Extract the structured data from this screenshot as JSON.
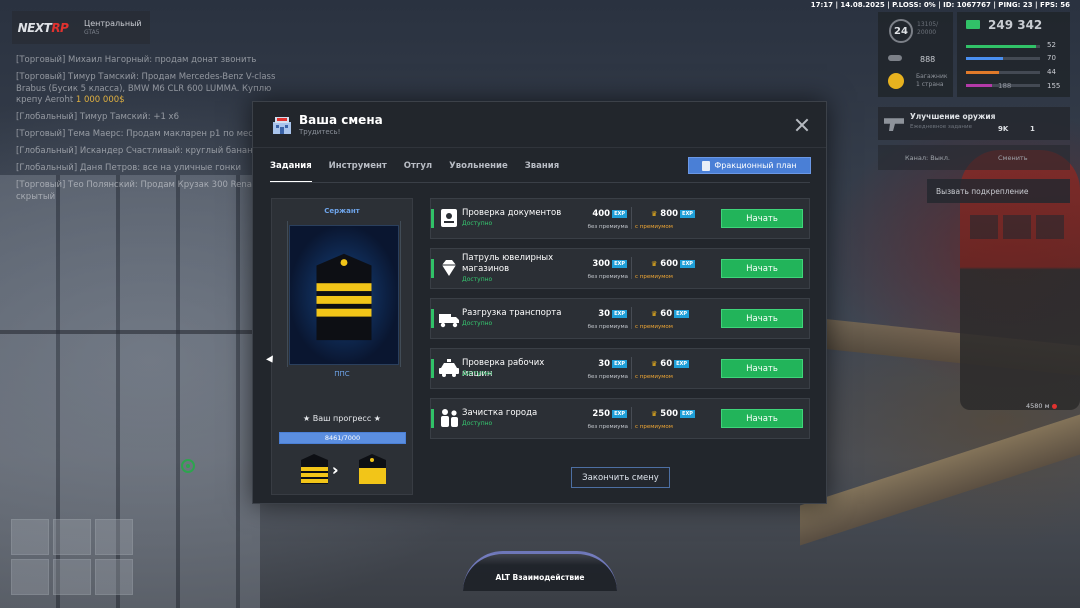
{
  "logo": {
    "brand_a": "NEXT",
    "brand_b": "RP",
    "server": "Центральный",
    "server_sub": "GTA5"
  },
  "topinfo": "17:17 | 14.08.2025 | P.LOSS: 0% | ID: 1067767 | PING: 23 | FPS: 56",
  "hud": {
    "level": "24",
    "level_text_1": "13105/",
    "level_text_2": "20000",
    "money": "249 342",
    "val_888": "888",
    "val_zero": "0",
    "val_rank_text_1": "Багажник",
    "val_rank_text_2": "1 страна",
    "stats": [
      "52",
      "70",
      "44",
      "155"
    ],
    "stat_bottom_left": "188",
    "bars": [
      {
        "color": "#31c268",
        "fill": 0.95
      },
      {
        "color": "#4a8ff0",
        "fill": 0.5
      },
      {
        "color": "#e07a2a",
        "fill": 0.45
      },
      {
        "color": "#b33aa8",
        "fill": 0.35
      }
    ]
  },
  "upgrade": {
    "title": "Улучшение оружия",
    "subtitle": "Ежедневное задание",
    "v1": "9K",
    "v2": "1",
    "side": "Интонация"
  },
  "channel": {
    "a": "Канал: Выкл.",
    "b": "Сменить"
  },
  "backup": "Вызвать подкрепление",
  "distance": "4580 м",
  "alt_hint": "ALT Взаимодействие",
  "chat": [
    {
      "text": "[Торговый] Михаил Нагорный: продам донат звонить",
      "amt": ""
    },
    {
      "text": "[Торговый] Тимур Тамский: Продам Mercedes-Benz V-class Brabus (Бусик 5 класса), BMW M6 CLR 600 LUMMA. Куплю крепу Aeroht",
      "amt": "1 000 000$"
    },
    {
      "text": "[Глобальный] Тимур Тамский: +1 x6",
      "amt": ""
    },
    {
      "text": "[Торговый] Тема Маерс: Продам макларен р1 по мест",
      "amt": ""
    },
    {
      "text": "[Глобальный] Искандер Счастливый: круглый банан",
      "amt": ""
    },
    {
      "text": "[Глобальный] Даня Петров: все на уличные гонки",
      "amt": ""
    },
    {
      "text": "[Торговый] Тео Полянский: Продам Крузак 300 Renault скрытый",
      "amt": ""
    }
  ],
  "modal": {
    "title": "Ваша смена",
    "subtitle": "Трудитесь!",
    "tabs": [
      "Задания",
      "Инструмент",
      "Отгул",
      "Увольнение",
      "Звания"
    ],
    "faction_plan": "Фракционный план",
    "rank_name": "Сержант",
    "unit": "ППС",
    "progress_title": "★ Ваш прогресс ★",
    "progress_label": "8461/7000",
    "progress_fill": 1,
    "end_shift": "Закончить смену",
    "exp_badge": "EXP",
    "no_premium": "без премиума",
    "with_premium": "с премиумом",
    "start_label": "Начать",
    "tasks": [
      {
        "name": "Проверка документов",
        "status": "Доступно",
        "base": "400",
        "premium": "800",
        "icon": "id-card-icon"
      },
      {
        "name": "Патруль ювелирных магазинов",
        "status": "Доступно",
        "base": "300",
        "premium": "600",
        "icon": "diamond-icon"
      },
      {
        "name": "Разгрузка транспорта",
        "status": "Доступно",
        "base": "30",
        "premium": "60",
        "icon": "truck-icon"
      },
      {
        "name": "Проверка рабочих машин",
        "status": "Доступно",
        "base": "30",
        "premium": "60",
        "icon": "police-car-icon"
      },
      {
        "name": "Зачистка города",
        "status": "Доступно",
        "base": "250",
        "premium": "500",
        "icon": "officers-icon"
      }
    ]
  }
}
